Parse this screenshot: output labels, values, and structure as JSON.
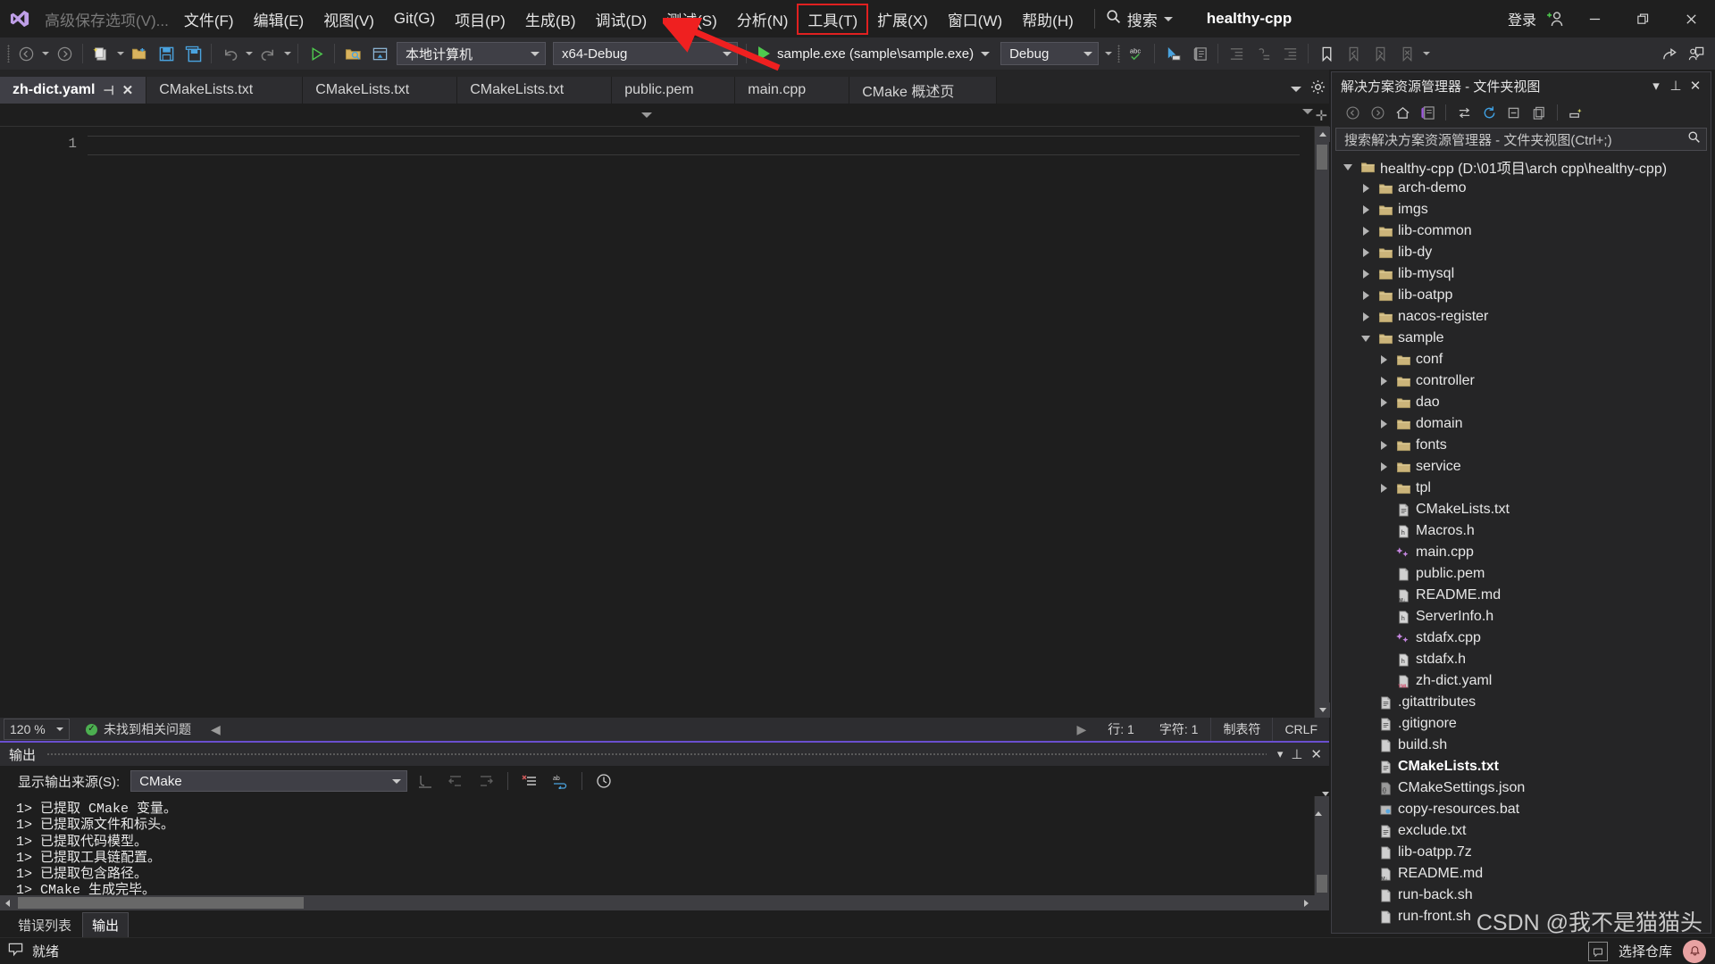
{
  "menubar": {
    "logo": "visual-studio-logo",
    "ghost_item": "高级保存选项(V)...",
    "items": [
      {
        "label": "文件(F)"
      },
      {
        "label": "编辑(E)"
      },
      {
        "label": "视图(V)"
      },
      {
        "label": "Git(G)"
      },
      {
        "label": "项目(P)"
      },
      {
        "label": "生成(B)"
      },
      {
        "label": "调试(D)"
      },
      {
        "label": "测试(S)"
      },
      {
        "label": "分析(N)"
      },
      {
        "label": "工具(T)"
      },
      {
        "label": "扩展(X)"
      },
      {
        "label": "窗口(W)"
      },
      {
        "label": "帮助(H)"
      }
    ],
    "highlighted_item": "工具(T)",
    "search_label": "搜索",
    "solution_name": "healthy-cpp",
    "login_label": "登录",
    "window_controls": {
      "minimize": "minimize-icon",
      "restore": "restore-icon",
      "close": "close-icon"
    }
  },
  "toolbar": {
    "target_system": "本地计算机",
    "configuration": "x64-Debug",
    "startup_item": "sample.exe (sample\\sample.exe)",
    "build_config": "Debug"
  },
  "editor": {
    "tabs": [
      {
        "label": "zh-dict.yaml",
        "active": true,
        "pin": "⊣",
        "close": "✕"
      },
      {
        "label": "CMakeLists.txt",
        "active": false
      },
      {
        "label": "CMakeLists.txt",
        "active": false
      },
      {
        "label": "CMakeLists.txt",
        "active": false
      },
      {
        "label": "public.pem",
        "active": false
      },
      {
        "label": "main.cpp",
        "active": false
      },
      {
        "label": "CMake 概述页",
        "active": false
      }
    ],
    "line_numbers": [
      "1"
    ],
    "content_lines": [
      ""
    ],
    "status": {
      "zoom": "120 %",
      "problems": "未找到相关问题",
      "line": "行: 1",
      "column": "字符: 1",
      "indent": "制表符",
      "eol": "CRLF"
    }
  },
  "output": {
    "title": "输出",
    "source_label": "显示输出来源(S):",
    "source_value": "CMake",
    "lines": [
      "1> 已提取 CMake 变量。",
      "1> 已提取源文件和标头。",
      "1> 已提取代码模型。",
      "1> 已提取工具链配置。",
      "1> 已提取包含路径。",
      "1> CMake 生成完毕。"
    ],
    "tabs": [
      {
        "label": "错误列表",
        "active": false
      },
      {
        "label": "输出",
        "active": true
      }
    ]
  },
  "solution_explorer": {
    "title": "解决方案资源管理器 - 文件夹视图",
    "search_placeholder": "搜索解决方案资源管理器 - 文件夹视图(Ctrl+;)",
    "tree": [
      {
        "label": "healthy-cpp (D:\\01项目\\arch cpp\\healthy-cpp)",
        "depth": 0,
        "twisty": "open",
        "icon": "folder",
        "bold": false
      },
      {
        "label": "arch-demo",
        "depth": 1,
        "twisty": "closed",
        "icon": "folder",
        "bold": false
      },
      {
        "label": "imgs",
        "depth": 1,
        "twisty": "closed",
        "icon": "folder",
        "bold": false
      },
      {
        "label": "lib-common",
        "depth": 1,
        "twisty": "closed",
        "icon": "folder",
        "bold": false
      },
      {
        "label": "lib-dy",
        "depth": 1,
        "twisty": "closed",
        "icon": "folder",
        "bold": false
      },
      {
        "label": "lib-mysql",
        "depth": 1,
        "twisty": "closed",
        "icon": "folder",
        "bold": false
      },
      {
        "label": "lib-oatpp",
        "depth": 1,
        "twisty": "closed",
        "icon": "folder",
        "bold": false
      },
      {
        "label": "nacos-register",
        "depth": 1,
        "twisty": "closed",
        "icon": "folder",
        "bold": false
      },
      {
        "label": "sample",
        "depth": 1,
        "twisty": "open",
        "icon": "folder",
        "bold": false
      },
      {
        "label": "conf",
        "depth": 2,
        "twisty": "closed",
        "icon": "folder",
        "bold": false
      },
      {
        "label": "controller",
        "depth": 2,
        "twisty": "closed",
        "icon": "folder",
        "bold": false
      },
      {
        "label": "dao",
        "depth": 2,
        "twisty": "closed",
        "icon": "folder",
        "bold": false
      },
      {
        "label": "domain",
        "depth": 2,
        "twisty": "closed",
        "icon": "folder",
        "bold": false
      },
      {
        "label": "fonts",
        "depth": 2,
        "twisty": "closed",
        "icon": "folder",
        "bold": false
      },
      {
        "label": "service",
        "depth": 2,
        "twisty": "closed",
        "icon": "folder",
        "bold": false
      },
      {
        "label": "tpl",
        "depth": 2,
        "twisty": "closed",
        "icon": "folder",
        "bold": false
      },
      {
        "label": "CMakeLists.txt",
        "depth": 2,
        "twisty": "none",
        "icon": "txt",
        "bold": false
      },
      {
        "label": "Macros.h",
        "depth": 2,
        "twisty": "none",
        "icon": "header",
        "bold": false
      },
      {
        "label": "main.cpp",
        "depth": 2,
        "twisty": "none",
        "icon": "cpp",
        "bold": false
      },
      {
        "label": "public.pem",
        "depth": 2,
        "twisty": "none",
        "icon": "blank",
        "bold": false
      },
      {
        "label": "README.md",
        "depth": 2,
        "twisty": "none",
        "icon": "md",
        "bold": false
      },
      {
        "label": "ServerInfo.h",
        "depth": 2,
        "twisty": "none",
        "icon": "header",
        "bold": false
      },
      {
        "label": "stdafx.cpp",
        "depth": 2,
        "twisty": "none",
        "icon": "cpp",
        "bold": false
      },
      {
        "label": "stdafx.h",
        "depth": 2,
        "twisty": "none",
        "icon": "header",
        "bold": false
      },
      {
        "label": "zh-dict.yaml",
        "depth": 2,
        "twisty": "none",
        "icon": "yml",
        "bold": false
      },
      {
        "label": ".gitattributes",
        "depth": 1,
        "twisty": "none",
        "icon": "txt",
        "bold": false
      },
      {
        "label": ".gitignore",
        "depth": 1,
        "twisty": "none",
        "icon": "txt",
        "bold": false
      },
      {
        "label": "build.sh",
        "depth": 1,
        "twisty": "none",
        "icon": "blank",
        "bold": false
      },
      {
        "label": "CMakeLists.txt",
        "depth": 1,
        "twisty": "none",
        "icon": "txt",
        "bold": true
      },
      {
        "label": "CMakeSettings.json",
        "depth": 1,
        "twisty": "none",
        "icon": "json",
        "bold": false
      },
      {
        "label": "copy-resources.bat",
        "depth": 1,
        "twisty": "none",
        "icon": "bat",
        "bold": false
      },
      {
        "label": "exclude.txt",
        "depth": 1,
        "twisty": "none",
        "icon": "txt",
        "bold": false
      },
      {
        "label": "lib-oatpp.7z",
        "depth": 1,
        "twisty": "none",
        "icon": "blank",
        "bold": false
      },
      {
        "label": "README.md",
        "depth": 1,
        "twisty": "none",
        "icon": "md",
        "bold": false
      },
      {
        "label": "run-back.sh",
        "depth": 1,
        "twisty": "none",
        "icon": "blank",
        "bold": false
      },
      {
        "label": "run-front.sh",
        "depth": 1,
        "twisty": "none",
        "icon": "blank",
        "bold": false
      }
    ]
  },
  "statusbar": {
    "ready": "就绪",
    "repo": "选择仓库"
  },
  "watermark": "CSDN @我不是猫猫头",
  "colors": {
    "accent": "#6a4fcf",
    "window_bg": "#1e1e1e",
    "toolbar_bg": "#2d2d30",
    "panel_bg": "#252526",
    "highlight_red": "#e02020",
    "folder": "#d9c38a",
    "run_green": "#4ec94e"
  }
}
